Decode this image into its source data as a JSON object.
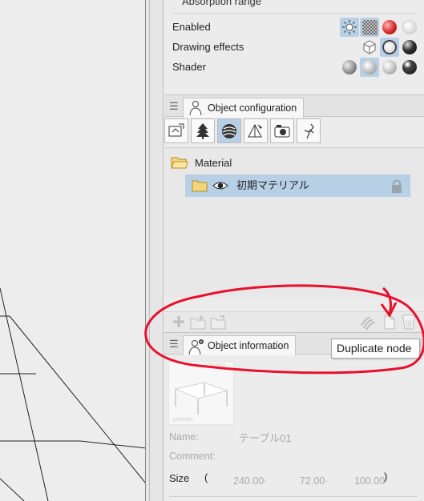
{
  "top_panel": {
    "cut_label": "Absorption range",
    "rows": [
      {
        "label": "Enabled"
      },
      {
        "label": "Drawing effects"
      },
      {
        "label": "Shader"
      }
    ]
  },
  "config_panel": {
    "tab_label": "Object configuration",
    "tree": {
      "root_label": "Material",
      "child_label": "初期マテリアル"
    }
  },
  "info_panel": {
    "tab_label": "Object information",
    "thumb_top": "100x240x",
    "thumb_bottom": "100x180x",
    "name_label": "Name:",
    "name_value": "テーブル01",
    "comment_label": "Comment:",
    "size_label": "Size",
    "size_open": "(",
    "size_close": ")",
    "size_x": "240.00·",
    "size_y": "72.00·",
    "size_z": "100.00"
  },
  "tooltip": {
    "text": "Duplicate node"
  },
  "colors": {
    "selection": "#b7d0e6",
    "annotation": "#e8112d"
  }
}
